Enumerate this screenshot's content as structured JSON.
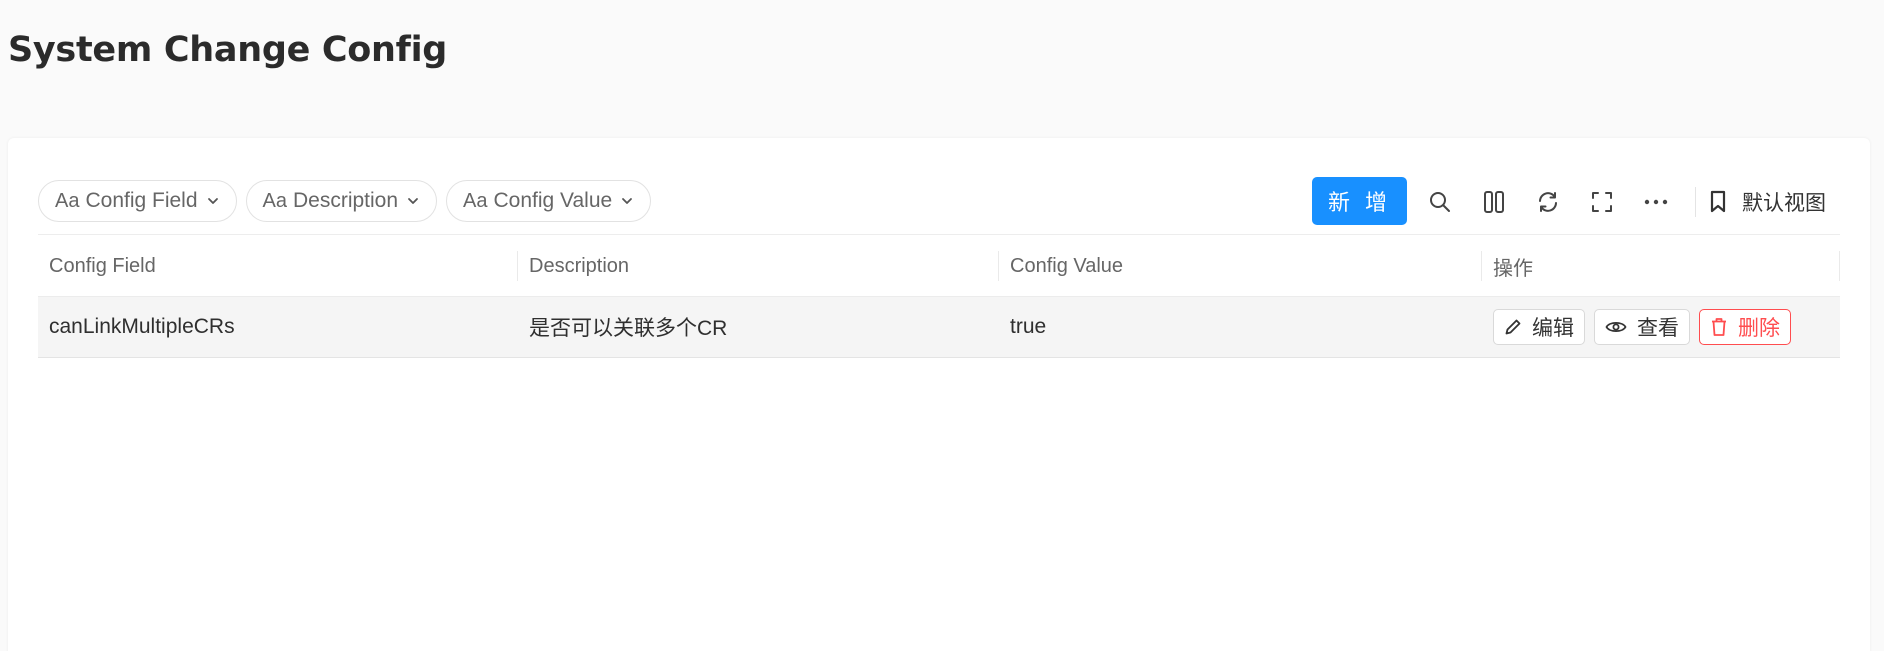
{
  "page": {
    "title": "System Change Config"
  },
  "filters": [
    {
      "prefix": "Aa",
      "label": "Config Field"
    },
    {
      "prefix": "Aa",
      "label": "Description"
    },
    {
      "prefix": "Aa",
      "label": "Config Value"
    }
  ],
  "toolbar": {
    "add_label": "新 增",
    "view_label": "默认视图",
    "icons": [
      "search-icon",
      "columns-icon",
      "refresh-icon",
      "fullscreen-icon",
      "more-icon",
      "bookmark-icon"
    ]
  },
  "table": {
    "columns": [
      "Config Field",
      "Description",
      "Config Value",
      "操作"
    ],
    "rows": [
      {
        "config_field": "canLinkMultipleCRs",
        "description": "是否可以关联多个CR",
        "config_value": "true"
      }
    ],
    "row_actions": {
      "edit": "编辑",
      "view": "查看",
      "delete": "删除"
    }
  },
  "colors": {
    "primary": "#1890ff",
    "danger": "#ff4d4f"
  }
}
